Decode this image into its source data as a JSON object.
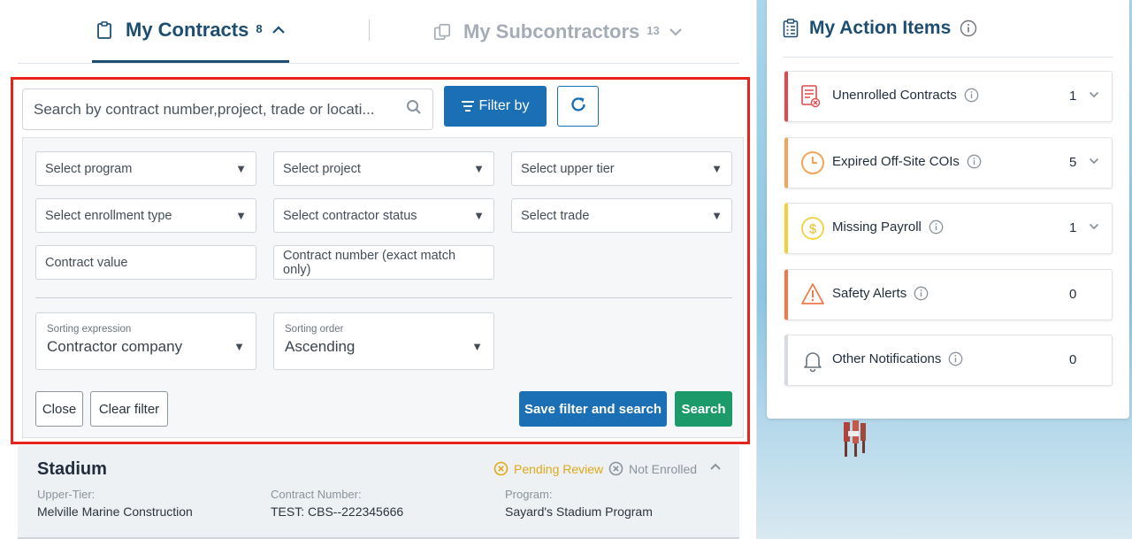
{
  "tabs": {
    "contracts_label": "My Contracts",
    "contracts_count": "8",
    "subcontractors_label": "My Subcontractors",
    "subcontractors_count": "13"
  },
  "search": {
    "placeholder": "Search by contract number,project, trade or locati..."
  },
  "toolbar": {
    "filter_label": "Filter by"
  },
  "filters": {
    "program": "Select program",
    "project": "Select project",
    "upper_tier": "Select upper tier",
    "enrollment_type": "Select enrollment type",
    "contractor_status": "Select contractor status",
    "trade": "Select trade",
    "contract_value_placeholder": "Contract value",
    "contract_number_placeholder": "Contract number (exact match only)",
    "sorting_expression_label": "Sorting expression",
    "sorting_expression_value": "Contractor company",
    "sorting_order_label": "Sorting order",
    "sorting_order_value": "Ascending"
  },
  "buttons": {
    "close": "Close",
    "clear_filter": "Clear filter",
    "save_filter_and_search": "Save filter and search",
    "search": "Search"
  },
  "contract_card": {
    "title": "Stadium",
    "status_pending": "Pending Review",
    "status_not_enrolled": "Not Enrolled",
    "upper_tier_label": "Upper-Tier:",
    "upper_tier_value": "Melville Marine Construction",
    "contract_number_label": "Contract Number:",
    "contract_number_value": "TEST: CBS--222345666",
    "program_label": "Program:",
    "program_value": "Sayard's Stadium Program"
  },
  "action_items": {
    "title": "My Action Items",
    "items": [
      {
        "label": "Unenrolled Contracts",
        "count": "1",
        "color": "#e04a4a",
        "icon": "contract-x-icon"
      },
      {
        "label": "Expired Off-Site COIs",
        "count": "5",
        "color": "#f2a65a",
        "icon": "clock-icon"
      },
      {
        "label": "Missing Payroll",
        "count": "1",
        "color": "#f2d13a",
        "icon": "dollar-coin-icon"
      },
      {
        "label": "Safety Alerts",
        "count": "0",
        "color": "#f07a4a",
        "icon": "warning-triangle-icon"
      },
      {
        "label": "Other Notifications",
        "count": "0",
        "color": "#d6d9dd",
        "icon": "bell-icon"
      }
    ]
  },
  "colors": {
    "primary": "#1a6fb5",
    "success": "#1c9a6a",
    "heading": "#1d4e72",
    "highlight_border": "#e8231a"
  }
}
